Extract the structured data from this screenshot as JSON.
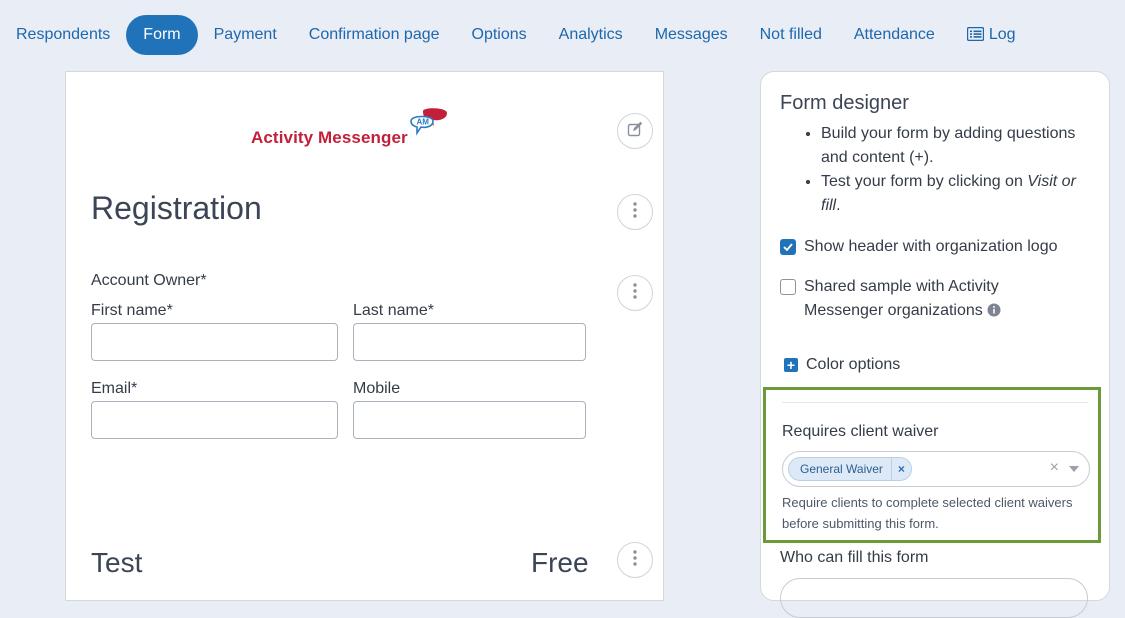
{
  "nav": {
    "items": [
      "Respondents",
      "Form",
      "Payment",
      "Confirmation page",
      "Options",
      "Analytics",
      "Messages",
      "Not filled",
      "Attendance"
    ],
    "log_label": "Log",
    "active": "Form"
  },
  "form": {
    "logo_text": "Activity Messenger",
    "logo_badge": "AM",
    "title": "Registration",
    "account_owner_label": "Account Owner*",
    "first_name_label": "First name*",
    "last_name_label": "Last name*",
    "email_label": "Email*",
    "mobile_label": "Mobile",
    "section_title": "Test",
    "section_price": "Free"
  },
  "panel": {
    "title": "Form designer",
    "bullets": {
      "b1": "Build your form by adding questions and content (+).",
      "b2_prefix": "Test your form by clicking on ",
      "b2_em": "Visit or fill",
      "b2_suffix": "."
    },
    "show_header_label": "Show header with organization logo",
    "show_header_checked": true,
    "shared_sample_label": "Shared sample with Activity Messenger organizations",
    "shared_sample_checked": false,
    "color_options_label": "Color options",
    "waiver": {
      "label": "Requires client waiver",
      "selected": [
        "General Waiver"
      ],
      "help": "Require clients to complete selected client waivers before submitting this form."
    },
    "who_can_fill_label": "Who can fill this form"
  },
  "colors": {
    "accent": "#2173b9",
    "nav_text": "#1e67ad",
    "brand_red": "#c41f3a",
    "highlight_border": "#6a9b38",
    "page_bg": "#e9edf5"
  },
  "icons": {
    "log": "list-icon",
    "edit": "edit-icon",
    "more": "more-vertical-icon",
    "info": "info-icon",
    "plus": "plus-square-icon",
    "check": "check-icon"
  }
}
